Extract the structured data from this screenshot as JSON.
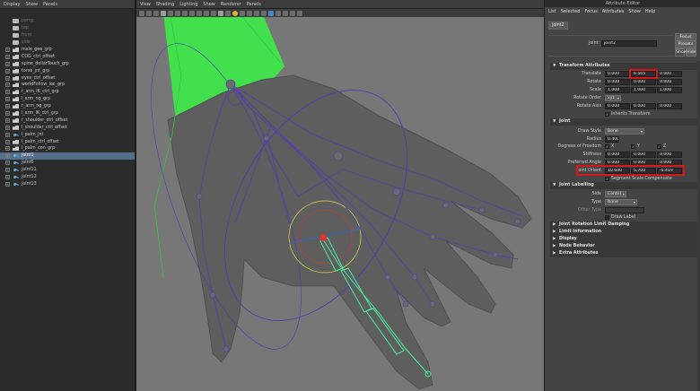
{
  "outliner": {
    "menu": [
      "Display",
      "Show",
      "Panels"
    ],
    "rows": [
      {
        "label": "persp",
        "icon": "camera",
        "dim": true,
        "expand": false
      },
      {
        "label": "top",
        "icon": "camera",
        "dim": true,
        "expand": false
      },
      {
        "label": "front",
        "icon": "camera",
        "dim": true,
        "expand": false
      },
      {
        "label": "side",
        "icon": "camera",
        "dim": true,
        "expand": false
      },
      {
        "label": "male_geo_grp",
        "icon": "group",
        "expand": true
      },
      {
        "label": "COG_ctrl_offset",
        "icon": "group",
        "expand": true
      },
      {
        "label": "spine_dollarTouch_grp",
        "icon": "group",
        "expand": true
      },
      {
        "label": "torso_jnt_grp",
        "icon": "group",
        "expand": true
      },
      {
        "label": "eyes_ctrl_offset",
        "icon": "group",
        "expand": true
      },
      {
        "label": "worldFollow_loc_grp",
        "icon": "group",
        "expand": true
      },
      {
        "label": "r_arm_IK_ctrl_grp",
        "icon": "group",
        "expand": true
      },
      {
        "label": "l_arm_ng_grp",
        "icon": "group",
        "expand": true
      },
      {
        "label": "r_arm_ng_grp",
        "icon": "group",
        "expand": true
      },
      {
        "label": "l_arm_IK_ctrl_grp",
        "icon": "group",
        "expand": true
      },
      {
        "label": "r_shoulder_ctrl_offset",
        "icon": "group",
        "expand": true
      },
      {
        "label": "l_shoulder_ctrl_offset",
        "icon": "group",
        "expand": true
      },
      {
        "label": "l_palm_jnt",
        "icon": "joint",
        "expand": true
      },
      {
        "label": "l_palm_ctrl_offset",
        "icon": "group",
        "expand": true
      },
      {
        "label": "l_palm_con_grp",
        "icon": "group",
        "expand": true
      },
      {
        "label": "joint1",
        "icon": "joint",
        "expand": true,
        "selected": true
      },
      {
        "label": "joint6",
        "icon": "joint",
        "expand": true
      },
      {
        "label": "joint11",
        "icon": "joint",
        "expand": true
      },
      {
        "label": "joint12",
        "icon": "joint",
        "expand": true
      },
      {
        "label": "joint13",
        "icon": "joint",
        "expand": true
      }
    ]
  },
  "viewport": {
    "menu": [
      "View",
      "Shading",
      "Lighting",
      "Show",
      "Renderer",
      "Panels"
    ]
  },
  "ae": {
    "title": "Attribute Editor",
    "menu": [
      "List",
      "Selected",
      "Focus",
      "Attributes",
      "Show",
      "Help"
    ],
    "tab": "joint2",
    "node_label": "joint:",
    "node_name": "joint2",
    "buttons": {
      "focus": "Focus",
      "presets": "Presets",
      "show": "Show",
      "hide": "Hide"
    },
    "transform": {
      "header": "Transform Attributes",
      "translate_label": "Translate",
      "translate": [
        "0.000",
        "6.565",
        "0.000"
      ],
      "rotate_label": "Rotate",
      "rotate": [
        "0.000",
        "0.000",
        "0.000"
      ],
      "scale_label": "Scale",
      "scale": [
        "1.000",
        "1.000",
        "1.000"
      ],
      "rotate_order_label": "Rotate Order",
      "rotate_order": "xyz",
      "rotate_axis_label": "Rotate Axis",
      "rotate_axis": [
        "0.000",
        "0.000",
        "0.000"
      ],
      "inherits": "Inherits Transform"
    },
    "joint": {
      "header": "Joint",
      "draw_style_label": "Draw Style",
      "draw_style": "Bone",
      "radius_label": "Radius",
      "radius": "0.400",
      "dof_label": "Degrees of Freedom",
      "dof": [
        "X",
        "Y",
        "Z"
      ],
      "stiffness_label": "Stiffness",
      "stiffness": [
        "0.000",
        "0.000",
        "0.000"
      ],
      "preferred_label": "Preferred Angle",
      "preferred": [
        "0.000",
        "0.000",
        "0.000"
      ],
      "orient_label": "Joint Orient",
      "orient": [
        "10.600",
        "5.700",
        "-5.419"
      ],
      "segment": "Segment Scale Compensate"
    },
    "labelling": {
      "header": "Joint Labelling",
      "side_label": "Side",
      "side": "Center",
      "type_label": "Type",
      "type": "None",
      "other_label": "Other Type",
      "draw_label": "Draw Label"
    },
    "collapsed": [
      "Joint Rotation Limit Damping",
      "Limit Information",
      "Display",
      "Node Behavior",
      "Extra Attributes"
    ]
  },
  "colors": {
    "selection": "#556e8c",
    "highlight_red": "#d41818",
    "joint_purple": "#5a3fa8",
    "selected_bone": "#48f0a0",
    "arm_green": "#41e04c"
  }
}
